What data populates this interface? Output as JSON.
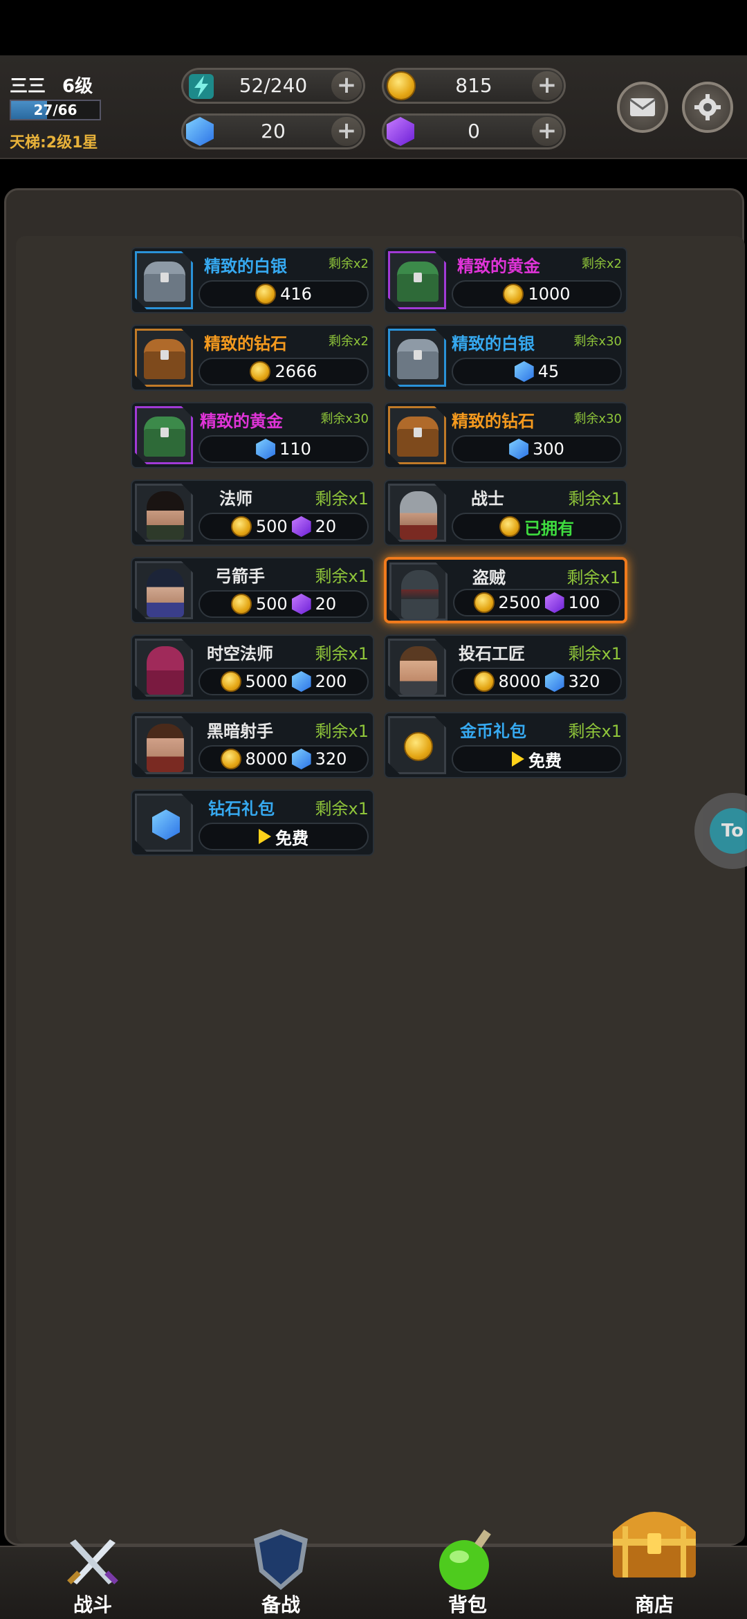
{
  "player": {
    "name": "三三",
    "level": "6级",
    "xp_text": "27/66",
    "xp_fraction": 0.41,
    "ladder": "天梯:2级1星"
  },
  "resources": {
    "energy": "52/240",
    "gold": "815",
    "blue_gems": "20",
    "purple_gems": "0",
    "plus": "+"
  },
  "shop": {
    "items": [
      {
        "title": "精致的白银",
        "remain": "剩余x2",
        "price": "416"
      },
      {
        "title": "精致的黄金",
        "remain": "剩余x2",
        "price": "1000"
      },
      {
        "title": "精致的钻石",
        "remain": "剩余x2",
        "price": "2666"
      },
      {
        "title": "精致的白银",
        "remain": "剩余x30",
        "price": "45"
      },
      {
        "title": "精致的黄金",
        "remain": "剩余x30",
        "price": "110"
      },
      {
        "title": "精致的钻石",
        "remain": "剩余x30",
        "price": "300"
      },
      {
        "title": "法师",
        "remain": "剩余x1",
        "gold": "500",
        "gem": "20"
      },
      {
        "title": "战士",
        "remain": "剩余x1",
        "status": "已拥有"
      },
      {
        "title": "弓箭手",
        "remain": "剩余x1",
        "gold": "500",
        "gem": "20"
      },
      {
        "title": "盗贼",
        "remain": "剩余x1",
        "gold": "2500",
        "gem": "100"
      },
      {
        "title": "时空法师",
        "remain": "剩余x1",
        "gold": "5000",
        "gem": "200"
      },
      {
        "title": "投石工匠",
        "remain": "剩余x1",
        "gold": "8000",
        "gem": "320"
      },
      {
        "title": "黑暗射手",
        "remain": "剩余x1",
        "gold": "8000",
        "gem": "320"
      },
      {
        "title": "金币礼包",
        "remain": "剩余x1",
        "free": "免费"
      },
      {
        "title": "钻石礼包",
        "remain": "剩余x1",
        "free": "免费"
      }
    ]
  },
  "floating": {
    "label": "To"
  },
  "nav": {
    "battle": "战斗",
    "prepare": "备战",
    "bag": "背包",
    "shop": "商店"
  },
  "colors": {
    "accent_orange": "#f07a1c",
    "remain_green": "#8fc53a",
    "owned_green": "#3fdc3f"
  }
}
